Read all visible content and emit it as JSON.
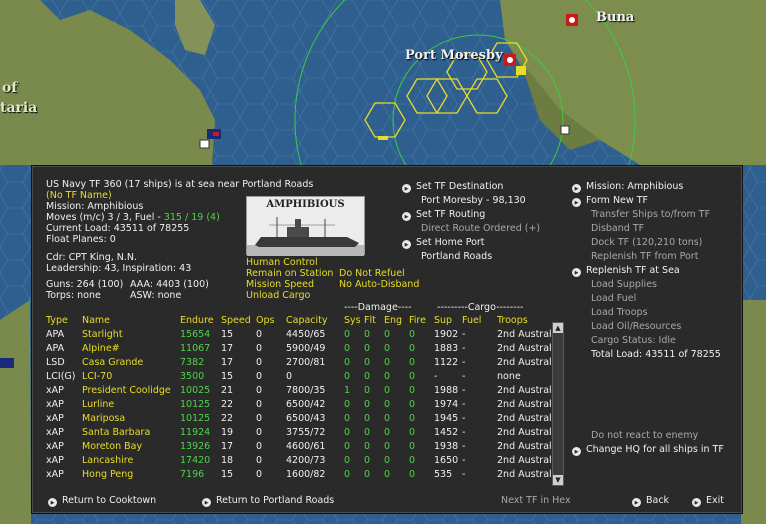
{
  "map": {
    "places": [
      "Buna",
      "Port Moresby",
      "of",
      "taria"
    ]
  },
  "tf": {
    "header": "US Navy TF 360 (17 ships) is at sea near Portland Roads",
    "name": "(No TF Name)",
    "mission": "Mission: Amphibious",
    "moves_label": "Moves (m/c)  3 / 3, Fuel - ",
    "moves_fuel": "315 / 19 (4)",
    "load": "Current Load:  43511 of 78255",
    "float": "Float Planes:  0",
    "cdr": "Cdr: CPT  King, N.N.",
    "leadership": "Leadership: 43, Inspiration: 43",
    "guns": "Guns: 264 (100)",
    "aaa": "AAA: 4403 (100)",
    "torps": "Torps: none",
    "asw": "ASW: none",
    "photo_caption": "AMPHIBIOUS",
    "orders": [
      "Human Control",
      "Remain on Station",
      "Mission Speed",
      "Unload Cargo"
    ],
    "orders2": [
      "Do Not Refuel",
      "No Auto-Disband"
    ]
  },
  "center_menu": {
    "set_dest": "Set TF Destination",
    "dest_value": "Port Moresby - 98,130",
    "set_routing": "Set TF Routing",
    "direct_route": "Direct Route Ordered (+)",
    "set_home": "Set Home Port",
    "home_value": "Portland Roads"
  },
  "right_menu": {
    "mission": "Mission: Amphibious",
    "form_new": "Form New TF",
    "transfer": "Transfer Ships to/from TF",
    "disband": "Disband TF",
    "dock": "Dock TF (120,210 tons)",
    "replenish_port": "Replenish TF from Port",
    "replenish_sea": "Replenish TF at Sea",
    "load_supplies": "Load Supplies",
    "load_fuel": "Load Fuel",
    "load_troops": "Load Troops",
    "load_oil": "Load Oil/Resources",
    "cargo_status": "Cargo Status: Idle",
    "total_load": "Total Load: 43511 of 78255",
    "no_react": "Do not react to enemy",
    "change_hq": "Change HQ for all ships in TF"
  },
  "table": {
    "group_damage": "----Damage----",
    "group_cargo": "---------Cargo--------",
    "headers": [
      "Type",
      "Name",
      "Endure",
      "Speed",
      "Ops",
      "Capacity",
      "Sys",
      "Flt",
      "Eng",
      "Fire",
      "Sup",
      "Fuel",
      "Troops"
    ],
    "rows": [
      {
        "type": "APA",
        "name": "Starlight",
        "endure": "15654",
        "speed": "15",
        "ops": "0",
        "cap": "4450/65",
        "sys": "0",
        "flt": "0",
        "eng": "0",
        "fire": "0",
        "sup": "1902",
        "fuel": "-",
        "troops": "2nd Australi"
      },
      {
        "type": "APA",
        "name": "Alpine#",
        "endure": "11067",
        "speed": "17",
        "ops": "0",
        "cap": "5900/49",
        "sys": "0",
        "flt": "0",
        "eng": "0",
        "fire": "0",
        "sup": "1883",
        "fuel": "-",
        "troops": "2nd Australi"
      },
      {
        "type": "LSD",
        "name": "Casa Grande",
        "endure": "7382",
        "speed": "17",
        "ops": "0",
        "cap": "2700/81",
        "sys": "0",
        "flt": "0",
        "eng": "0",
        "fire": "0",
        "sup": "1122",
        "fuel": "-",
        "troops": "2nd Australi"
      },
      {
        "type": "LCI(G)",
        "name": "LCI-70",
        "endure": "3500",
        "speed": "15",
        "ops": "0",
        "cap": "0",
        "sys": "0",
        "flt": "0",
        "eng": "0",
        "fire": "0",
        "sup": "-",
        "fuel": "-",
        "troops": "none"
      },
      {
        "type": "xAP",
        "name": "President Coolidge",
        "endure": "10025",
        "speed": "21",
        "ops": "0",
        "cap": "7800/35",
        "sys": "1",
        "flt": "0",
        "eng": "0",
        "fire": "0",
        "sup": "1988",
        "fuel": "-",
        "troops": "2nd Australi"
      },
      {
        "type": "xAP",
        "name": "Lurline",
        "endure": "10125",
        "speed": "22",
        "ops": "0",
        "cap": "6500/42",
        "sys": "0",
        "flt": "0",
        "eng": "0",
        "fire": "0",
        "sup": "1974",
        "fuel": "-",
        "troops": "2nd Australi"
      },
      {
        "type": "xAP",
        "name": "Mariposa",
        "endure": "10125",
        "speed": "22",
        "ops": "0",
        "cap": "6500/43",
        "sys": "0",
        "flt": "0",
        "eng": "0",
        "fire": "0",
        "sup": "1945",
        "fuel": "-",
        "troops": "2nd Australi"
      },
      {
        "type": "xAP",
        "name": "Santa Barbara",
        "endure": "11924",
        "speed": "19",
        "ops": "0",
        "cap": "3755/72",
        "sys": "0",
        "flt": "0",
        "eng": "0",
        "fire": "0",
        "sup": "1452",
        "fuel": "-",
        "troops": "2nd Australi"
      },
      {
        "type": "xAP",
        "name": "Moreton Bay",
        "endure": "13926",
        "speed": "17",
        "ops": "0",
        "cap": "4600/61",
        "sys": "0",
        "flt": "0",
        "eng": "0",
        "fire": "0",
        "sup": "1938",
        "fuel": "-",
        "troops": "2nd Australi"
      },
      {
        "type": "xAP",
        "name": "Lancashire",
        "endure": "17420",
        "speed": "18",
        "ops": "0",
        "cap": "4200/73",
        "sys": "0",
        "flt": "0",
        "eng": "0",
        "fire": "0",
        "sup": "1650",
        "fuel": "-",
        "troops": "2nd Australi"
      },
      {
        "type": "xAP",
        "name": "Hong Peng",
        "endure": "7196",
        "speed": "15",
        "ops": "0",
        "cap": "1600/82",
        "sys": "0",
        "flt": "0",
        "eng": "0",
        "fire": "0",
        "sup": "535",
        "fuel": "-",
        "troops": "2nd Australi"
      }
    ]
  },
  "footer": {
    "return_cooktown": "Return to Cooktown",
    "return_portland": "Return to Portland Roads",
    "next_tf": "Next TF in Hex",
    "back": "Back",
    "exit": "Exit"
  },
  "colors": {
    "panel": "#2a2a2a",
    "ship_name": "#e9dd26",
    "endure": "#4fd44a",
    "sea": "#2e5f8e",
    "land": "#7c8c4a"
  }
}
